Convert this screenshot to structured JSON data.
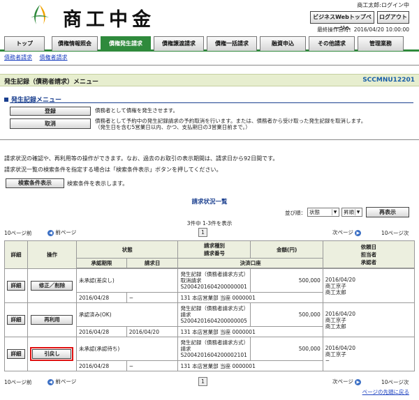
{
  "header": {
    "logo_text": "商工中金",
    "user": "商工太郎:ログイン中",
    "top_page_btn": "ビジネスWebトップページへ",
    "logout_btn": "ログアウト",
    "last_op": "最終操作日時：2016/04/20 10:00:00"
  },
  "tabs": [
    "トップ",
    "債権情報照会",
    "債権発生請求",
    "債権譲渡請求",
    "債権一括請求",
    "融資申込",
    "その他請求",
    "管理業務"
  ],
  "subnav": [
    "債務者請求",
    "債権者請求"
  ],
  "title": {
    "text": "発生記録（債務者請求）メニュー",
    "code": "SCCMNU12201"
  },
  "menu": {
    "heading": "発生記録メニュー",
    "register_btn": "登録",
    "register_desc": "債務者として債権を発生させます。",
    "cancel_btn": "取消",
    "cancel_desc1": "債務者として予約中の発生記録請求の予約取消を行います。または、債務者から受け取った発生記録を取消します。",
    "cancel_desc2": "（発生日を含む5営業日以内、かつ、支払期日の3営業日前まで。）"
  },
  "info1": "請求状況の確認や、再利用等の操作ができます。なお、過去のお取引の表示期間は、請求日から92日間です。",
  "info2": "請求状況一覧の検索条件を指定する場合は「検索条件表示」ボタンを押してください。",
  "search_btn": "検索条件表示",
  "search_desc": "検索条件を表示します。",
  "list": {
    "heading": "請求状況一覧",
    "sort_label": "並び順：",
    "sort_value": "状態",
    "order_value": "昇順",
    "rearrange_btn": "再表示",
    "count": "3件中 1-3件を表示",
    "prev10": "10ページ前",
    "prev": "前ページ",
    "page": "1",
    "next": "次ページ",
    "next10": "10ページ次",
    "back_top": "ページの先頭に戻る"
  },
  "table": {
    "h_detail": "詳細",
    "h_op": "操作",
    "h_status": "状態",
    "h_type": "請求種別",
    "h_reqno": "請求番号",
    "h_amount": "金額(円)",
    "h_date": "依頼日",
    "h_approval_deadline": "承認期限",
    "h_request_date": "請求日",
    "h_account": "決済口座",
    "h_staff": "担当者",
    "h_approver": "承認者",
    "rows": [
      {
        "detail": "詳細",
        "op": "修正／削除",
        "status": "未承認(差戻し)",
        "type": "発生記録（債務者請求方式）取消請求",
        "reqno": "S2004201604200000001",
        "amount": "500,000",
        "deadline": "2016/04/28",
        "reqdate": "−",
        "account": "131 本店営業部 当座 0000001",
        "date": "2016/04/20",
        "staff": "商工京子",
        "approver": "商工太郎"
      },
      {
        "detail": "詳細",
        "op": "再利用",
        "status": "承認済み(OK)",
        "type": "発生記録（債務者請求方式）請求",
        "reqno": "S2004201604200000005",
        "amount": "500,000",
        "deadline": "2016/04/28",
        "reqdate": "2016/04/20",
        "account": "131 本店営業部 当座 0000001",
        "date": "2016/04/20",
        "staff": "商工京子",
        "approver": "商工太郎"
      },
      {
        "detail": "詳細",
        "op": "引戻し",
        "status": "未承認(承認待ち)",
        "type": "発生記録（債務者請求方式）請求",
        "reqno": "S2004201604200002101",
        "amount": "500,000",
        "deadline": "2016/04/28",
        "reqdate": "−",
        "account": "131 本店営業部 当座 0000001",
        "date": "2016/04/20",
        "staff": "商工京子",
        "approver": "−"
      }
    ]
  }
}
